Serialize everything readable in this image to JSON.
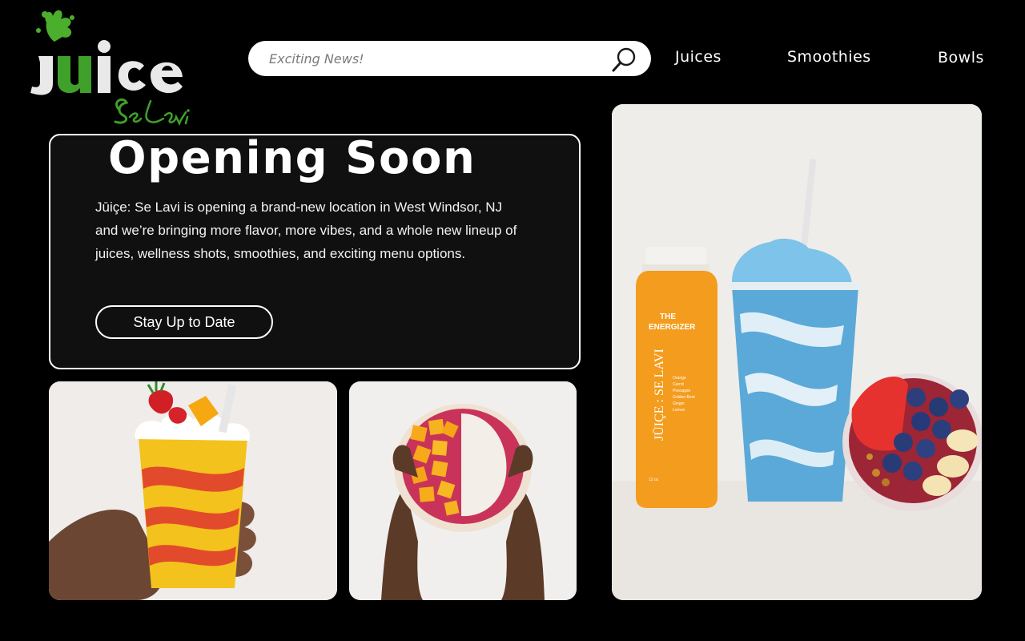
{
  "brand": {
    "logo_word": "Jüice",
    "logo_tagline": "Se Lavi",
    "colors": {
      "green": "#4cae2d",
      "dark_green": "#2f7d1c",
      "white": "#ffffff",
      "black": "#000000"
    }
  },
  "search": {
    "placeholder": "Exciting News!",
    "icon": "search-icon"
  },
  "nav": {
    "items": [
      {
        "label": "Juices"
      },
      {
        "label": "Smoothies"
      },
      {
        "label": "Bowls"
      }
    ]
  },
  "hero": {
    "title": "Opening Soon",
    "body": "Jūiçe: Se Lavi is opening a brand-new location in West Windsor, NJ and we’re bringing more flavor, more vibes, and a whole new lineup of juices, wellness shots, smoothies, and exciting menu options.",
    "cta_label": "Stay Up to Date"
  },
  "product_bottle": {
    "name_line1": "THE",
    "name_line2": "ENERGIZER",
    "brand_vertical": "JŪIÇE : SE LAVI",
    "ingredients": [
      "Orange",
      "Carrot",
      "Pineapple",
      "Golden Beet",
      "Ginger",
      "Lemon"
    ],
    "size": "12 oz"
  }
}
